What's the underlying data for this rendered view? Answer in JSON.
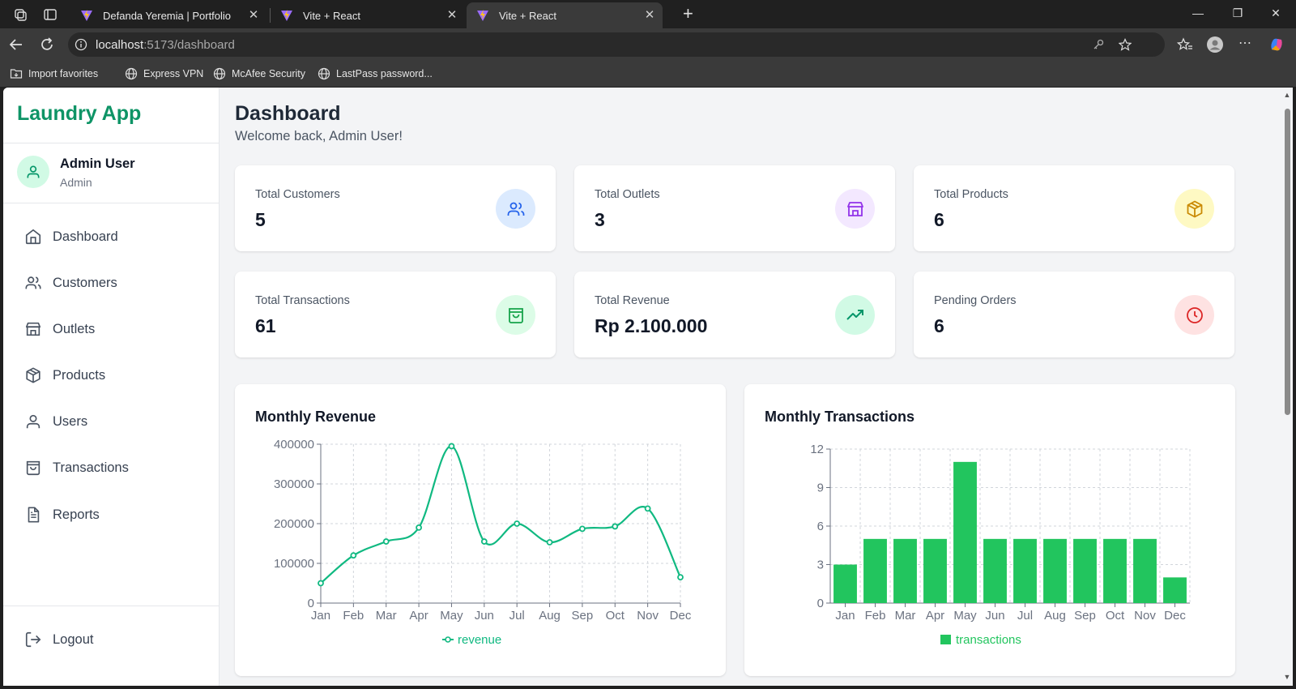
{
  "browser": {
    "tabs": [
      {
        "title": "Defanda Yeremia | Portfolio",
        "active": false
      },
      {
        "title": "Vite + React",
        "active": false
      },
      {
        "title": "Vite + React",
        "active": true
      }
    ],
    "url_host": "localhost",
    "url_path": ":5173/dashboard",
    "bookmarks": [
      "Import favorites",
      "Express VPN",
      "McAfee Security",
      "LastPass password..."
    ]
  },
  "sidebar": {
    "brand": "Laundry App",
    "user": {
      "name": "Admin User",
      "role": "Admin"
    },
    "menu": [
      "Dashboard",
      "Customers",
      "Outlets",
      "Products",
      "Users",
      "Transactions",
      "Reports"
    ],
    "logout": "Logout"
  },
  "header": {
    "title": "Dashboard",
    "subtitle": "Welcome back, Admin User!"
  },
  "stats": [
    {
      "label": "Total Customers",
      "value": "5",
      "icon": "users-icon",
      "bg": "#dbeafe",
      "color": "#2563eb"
    },
    {
      "label": "Total Outlets",
      "value": "3",
      "icon": "store-icon",
      "bg": "#f3e8ff",
      "color": "#9333ea"
    },
    {
      "label": "Total Products",
      "value": "6",
      "icon": "package-icon",
      "bg": "#fef9c3",
      "color": "#ca8a04"
    },
    {
      "label": "Total Transactions",
      "value": "61",
      "icon": "shopping-bag-icon",
      "bg": "#dcfce7",
      "color": "#16a34a"
    },
    {
      "label": "Total Revenue",
      "value": "Rp 2.100.000",
      "icon": "trending-up-icon",
      "bg": "#d1fae5",
      "color": "#059669"
    },
    {
      "label": "Pending Orders",
      "value": "6",
      "icon": "clock-icon",
      "bg": "#fee2e2",
      "color": "#dc2626"
    }
  ],
  "chart_data": [
    {
      "type": "line",
      "title": "Monthly Revenue",
      "categories": [
        "Jan",
        "Feb",
        "Mar",
        "Apr",
        "May",
        "Jun",
        "Jul",
        "Aug",
        "Sep",
        "Oct",
        "Nov",
        "Dec"
      ],
      "series": [
        {
          "name": "revenue",
          "values": [
            50000,
            120000,
            155000,
            190000,
            395000,
            155000,
            200000,
            153000,
            187000,
            193000,
            238000,
            65000
          ]
        }
      ],
      "ylim": [
        0,
        400000
      ],
      "yticks": [
        "0",
        "100000",
        "200000",
        "300000",
        "400000"
      ],
      "grid": true,
      "legend": "bottom",
      "color": "#10b981"
    },
    {
      "type": "bar",
      "title": "Monthly Transactions",
      "categories": [
        "Jan",
        "Feb",
        "Mar",
        "Apr",
        "May",
        "Jun",
        "Jul",
        "Aug",
        "Sep",
        "Oct",
        "Nov",
        "Dec"
      ],
      "series": [
        {
          "name": "transactions",
          "values": [
            3,
            5,
            5,
            5,
            11,
            5,
            5,
            5,
            5,
            5,
            5,
            2
          ]
        }
      ],
      "ylim": [
        0,
        12
      ],
      "yticks": [
        "0",
        "3",
        "6",
        "9",
        "12"
      ],
      "grid": true,
      "legend": "bottom",
      "color": "#22c55e"
    }
  ]
}
